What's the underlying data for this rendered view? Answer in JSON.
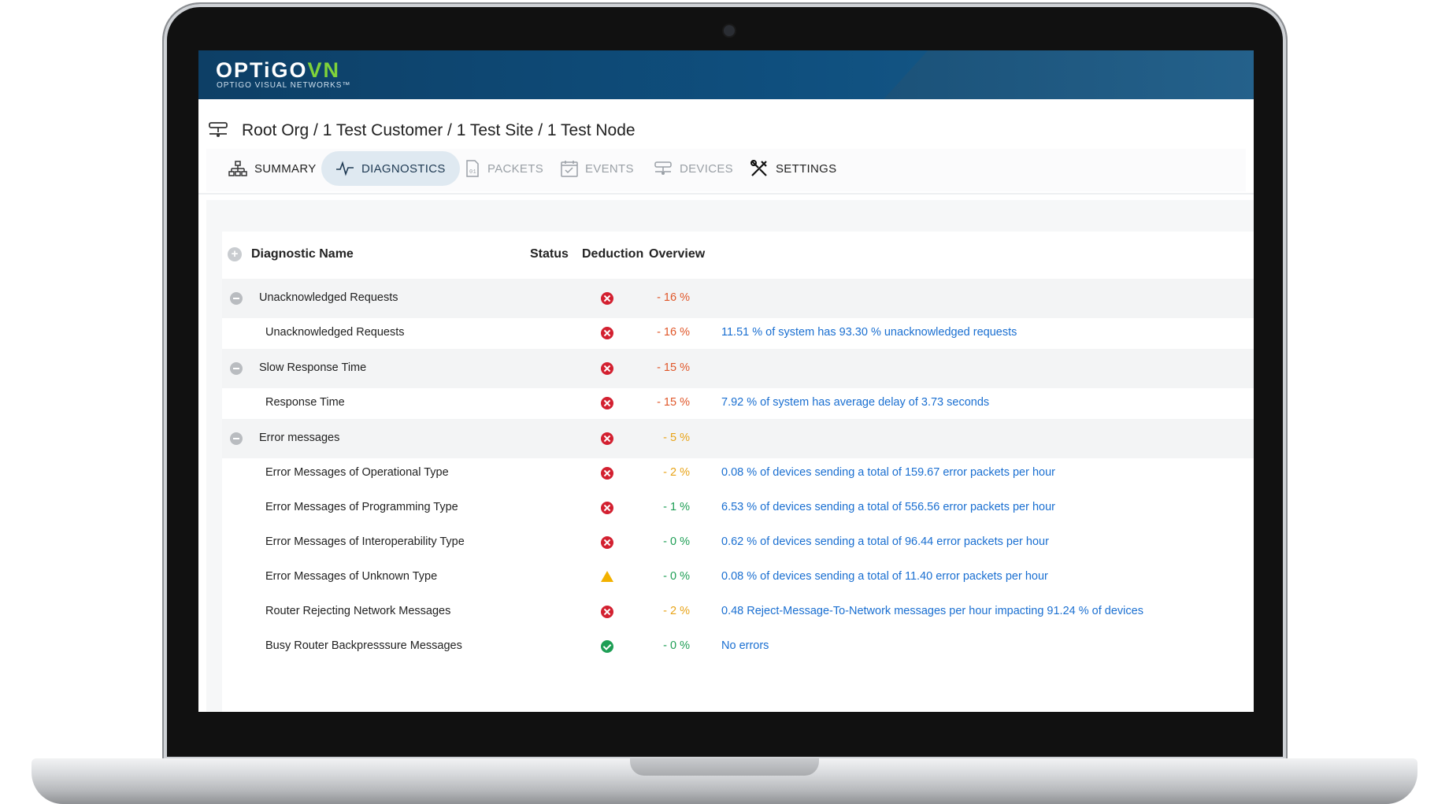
{
  "brand": {
    "main": "OPTiGO",
    "accent": "VN",
    "sub": "OPTIGO VISUAL NETWORKS™"
  },
  "breadcrumb": "Root Org / 1 Test Customer / 1 Test Site / 1 Test Node",
  "tabs": [
    {
      "label": "SUMMARY",
      "icon": "network-tree-icon",
      "state": "normal"
    },
    {
      "label": "DIAGNOSTICS",
      "icon": "pulse-icon",
      "state": "active"
    },
    {
      "label": "PACKETS",
      "icon": "packet-file-icon",
      "state": "disabled"
    },
    {
      "label": "EVENTS",
      "icon": "calendar-check-icon",
      "state": "disabled"
    },
    {
      "label": "DEVICES",
      "icon": "device-icon",
      "state": "disabled"
    },
    {
      "label": "SETTINGS",
      "icon": "tools-icon",
      "state": "normal"
    }
  ],
  "table": {
    "headers": {
      "name": "Diagnostic Name",
      "status": "Status",
      "deduction": "Deduction",
      "overview": "Overview"
    },
    "rows": [
      {
        "type": "group",
        "name": "Unacknowledged Requests",
        "status": "error",
        "deduction": "- 16 %",
        "deduction_color": "#e0572a",
        "overview": ""
      },
      {
        "type": "child",
        "name": "Unacknowledged Requests",
        "status": "error",
        "deduction": "- 16 %",
        "deduction_color": "#e0572a",
        "overview": "11.51 % of system has 93.30 % unacknowledged requests"
      },
      {
        "type": "group",
        "name": "Slow Response Time",
        "status": "error",
        "deduction": "- 15 %",
        "deduction_color": "#e0572a",
        "overview": ""
      },
      {
        "type": "child",
        "name": "Response Time",
        "status": "error",
        "deduction": "- 15 %",
        "deduction_color": "#e0572a",
        "overview": "7.92 % of system has average delay of 3.73 seconds"
      },
      {
        "type": "group",
        "name": "Error messages",
        "status": "error",
        "deduction": "- 5 %",
        "deduction_color": "#e8a317",
        "overview": ""
      },
      {
        "type": "child",
        "name": "Error Messages of Operational Type",
        "status": "error",
        "deduction": "- 2 %",
        "deduction_color": "#e8a317",
        "overview": "0.08 % of devices sending a total of 159.67 error packets per hour"
      },
      {
        "type": "child",
        "name": "Error Messages of Programming Type",
        "status": "error",
        "deduction": "- 1 %",
        "deduction_color": "#1e9e55",
        "overview": "6.53 % of devices sending a total of 556.56 error packets per hour"
      },
      {
        "type": "child",
        "name": "Error Messages of Interoperability Type",
        "status": "error",
        "deduction": "- 0 %",
        "deduction_color": "#1e9e55",
        "overview": "0.62 % of devices sending a total of 96.44 error packets per hour"
      },
      {
        "type": "child",
        "name": "Error Messages of Unknown Type",
        "status": "warning",
        "deduction": "- 0 %",
        "deduction_color": "#1e9e55",
        "overview": "0.08 % of devices sending a total of 11.40 error packets per hour"
      },
      {
        "type": "child",
        "name": "Router Rejecting Network Messages",
        "status": "error",
        "deduction": "- 2 %",
        "deduction_color": "#e8a317",
        "overview": "0.48 Reject-Message-To-Network messages per hour impacting 91.24 % of devices"
      },
      {
        "type": "child",
        "name": "Busy Router Backpresssure Messages",
        "status": "ok",
        "deduction": "- 0 %",
        "deduction_color": "#1e9e55",
        "overview": "No errors"
      }
    ]
  }
}
